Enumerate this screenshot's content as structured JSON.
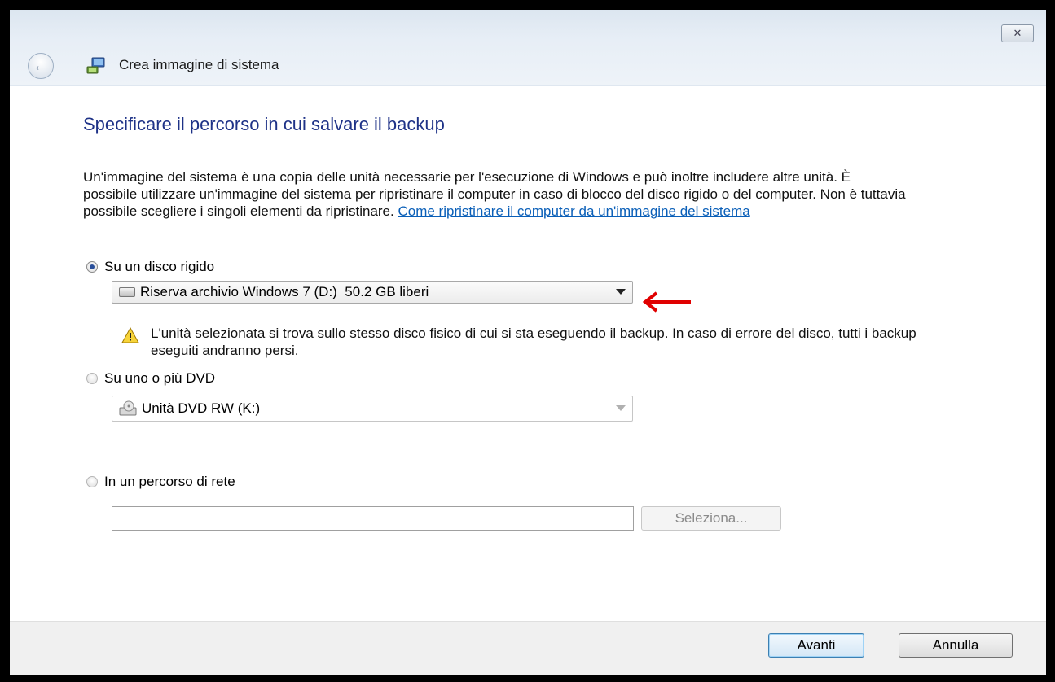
{
  "window": {
    "title": "Crea immagine di sistema",
    "close_glyph": "✕",
    "back_glyph": "←"
  },
  "main": {
    "heading": "Specificare il percorso in cui salvare il backup",
    "description": "Un'immagine del sistema è una copia delle unità necessarie per l'esecuzione di Windows e può inoltre includere altre unità. È possibile utilizzare un'immagine del sistema per ripristinare il computer in caso di blocco del disco rigido o del computer. Non è tuttavia possibile scegliere i singoli elementi da ripristinare.",
    "help_link": "Come ripristinare il computer da un'immagine del sistema"
  },
  "options": {
    "hard_disk": {
      "label": "Su un disco rigido",
      "selected": true,
      "drive_value": "Riserva archivio Windows 7 (D:)  50.2 GB liberi",
      "warning": "L'unità selezionata si trova sullo stesso disco fisico di cui si sta eseguendo il backup. In caso di errore del disco, tutti i backup eseguiti andranno persi."
    },
    "dvd": {
      "label": "Su uno o più DVD",
      "selected": false,
      "drive_value": "Unità DVD RW (K:)"
    },
    "network": {
      "label": "In un percorso di rete",
      "selected": false,
      "path_value": "",
      "select_button": "Seleziona..."
    }
  },
  "footer": {
    "next_button": "Avanti",
    "cancel_button": "Annulla"
  },
  "icons": {
    "warning": "warning-triangle-icon",
    "drive": "hard-drive-icon",
    "dvd": "dvd-drive-icon",
    "annotation_arrow": "red-arrow-icon"
  },
  "colors": {
    "heading": "#1e3287",
    "link": "#0a5fb8",
    "annotation_arrow": "#e00000"
  }
}
